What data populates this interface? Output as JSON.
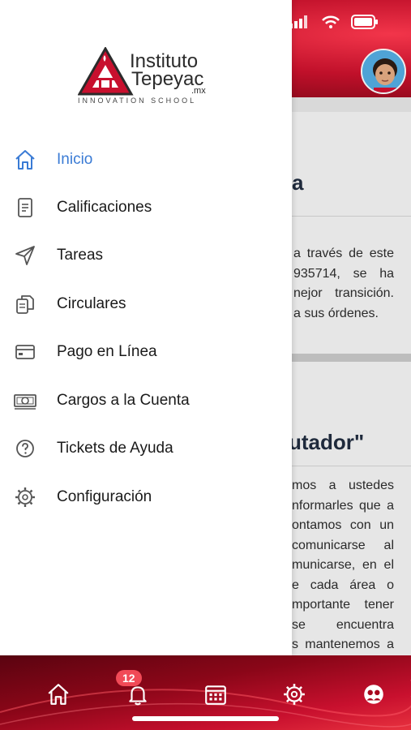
{
  "brand": {
    "name_line1": "Instituto",
    "name_line2": "Tepeyac",
    "suffix": ".mx",
    "tagline": "INNOVATION SCHOOL",
    "accent": "#c8102e"
  },
  "drawer": {
    "items": [
      {
        "label": "Inicio",
        "icon": "home-icon",
        "active": true
      },
      {
        "label": "Calificaciones",
        "icon": "document-icon",
        "active": false
      },
      {
        "label": "Tareas",
        "icon": "send-icon",
        "active": false
      },
      {
        "label": "Circulares",
        "icon": "files-icon",
        "active": false
      },
      {
        "label": "Pago en Línea",
        "icon": "credit-card-icon",
        "active": false
      },
      {
        "label": "Cargos a la Cuenta",
        "icon": "cash-icon",
        "active": false
      },
      {
        "label": "Tickets de Ayuda",
        "icon": "help-icon",
        "active": false
      },
      {
        "label": "Configuración",
        "icon": "gear-icon",
        "active": false
      }
    ],
    "active_color": "#3a7bd5"
  },
  "background": {
    "card1": {
      "title_fragment": "a",
      "lines": [
        "a través de este",
        "935714, se ha",
        "nejor transición.",
        "a sus órdenes."
      ]
    },
    "card2": {
      "title_fragment": "utador\"",
      "lines": [
        "mos a ustedes",
        "nformarles que a",
        "ontamos con un",
        "comunicarse al",
        "municarse, en el",
        "e cada área o",
        "mportante tener",
        "se encuentra",
        "s mantenemos a"
      ]
    }
  },
  "tabbar": {
    "notification_badge": "12",
    "tabs": [
      "home-icon",
      "bell-icon",
      "calendar-icon",
      "gear-icon",
      "profile-icon"
    ]
  }
}
